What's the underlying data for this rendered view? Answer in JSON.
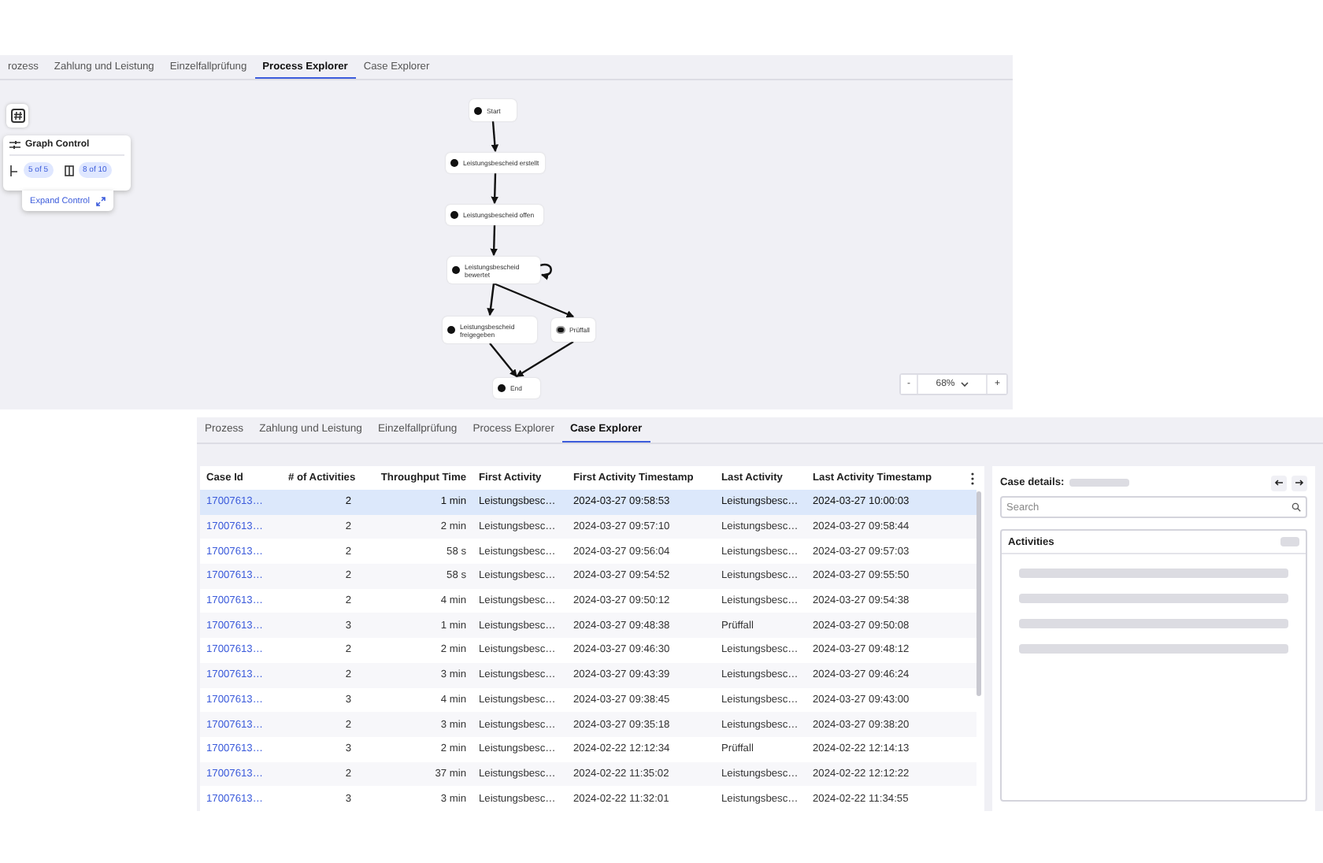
{
  "process_explorer": {
    "tabs": [
      {
        "label": "rozess",
        "selected": false
      },
      {
        "label": "Zahlung und Leistung",
        "selected": false
      },
      {
        "label": "Einzelfallprüfung",
        "selected": false
      },
      {
        "label": "Process Explorer",
        "selected": true
      },
      {
        "label": "Case Explorer",
        "selected": false
      }
    ],
    "graph_control": {
      "title": "Graph Control",
      "activities_badge": "5 of 5",
      "paths_badge": "8 of 10",
      "expand_label": "Expand Control"
    },
    "graph": {
      "nodes": [
        {
          "label": "Start",
          "kind": "start"
        },
        {
          "label": "Leistungsbescheid erstellt",
          "kind": "activity"
        },
        {
          "label": "Leistungsbescheid offen",
          "kind": "activity"
        },
        {
          "label": "Leistungsbescheid bewertet",
          "kind": "activity"
        },
        {
          "label": "Leistungsbescheid freigegeben",
          "kind": "activity"
        },
        {
          "label": "Prüffall",
          "kind": "activity"
        },
        {
          "label": "End",
          "kind": "end"
        }
      ]
    },
    "zoom": {
      "minus": "-",
      "value": "68%",
      "plus": "+"
    }
  },
  "case_explorer": {
    "tabs": [
      {
        "label": "Prozess",
        "selected": false
      },
      {
        "label": "Zahlung und Leistung",
        "selected": false
      },
      {
        "label": "Einzelfallprüfung",
        "selected": false
      },
      {
        "label": "Process Explorer",
        "selected": false
      },
      {
        "label": "Case Explorer",
        "selected": true
      }
    ],
    "table": {
      "columns": [
        "Case Id",
        "# of Activities",
        "Throughput Time",
        "First Activity",
        "First Activity Timestamp",
        "Last Activity",
        "Last Activity Timestamp"
      ],
      "rows": [
        {
          "selected": true,
          "cells": [
            "17007613…",
            "2",
            "1 min",
            "Leistungsbesc…",
            "2024-03-27 09:58:53",
            "Leistungsbesc…",
            "2024-03-27 10:00:03"
          ]
        },
        {
          "selected": false,
          "cells": [
            "17007613…",
            "2",
            "2 min",
            "Leistungsbesc…",
            "2024-03-27 09:57:10",
            "Leistungsbesc…",
            "2024-03-27 09:58:44"
          ]
        },
        {
          "selected": false,
          "cells": [
            "17007613…",
            "2",
            "58 s",
            "Leistungsbesc…",
            "2024-03-27 09:56:04",
            "Leistungsbesc…",
            "2024-03-27 09:57:03"
          ]
        },
        {
          "selected": false,
          "cells": [
            "17007613…",
            "2",
            "58 s",
            "Leistungsbesc…",
            "2024-03-27 09:54:52",
            "Leistungsbesc…",
            "2024-03-27 09:55:50"
          ]
        },
        {
          "selected": false,
          "cells": [
            "17007613…",
            "2",
            "4 min",
            "Leistungsbesc…",
            "2024-03-27 09:50:12",
            "Leistungsbesc…",
            "2024-03-27 09:54:38"
          ]
        },
        {
          "selected": false,
          "cells": [
            "17007613…",
            "3",
            "1 min",
            "Leistungsbesc…",
            "2024-03-27 09:48:38",
            "Prüffall",
            "2024-03-27 09:50:08"
          ]
        },
        {
          "selected": false,
          "cells": [
            "17007613…",
            "2",
            "2 min",
            "Leistungsbesc…",
            "2024-03-27 09:46:30",
            "Leistungsbesc…",
            "2024-03-27 09:48:12"
          ]
        },
        {
          "selected": false,
          "cells": [
            "17007613…",
            "2",
            "3 min",
            "Leistungsbesc…",
            "2024-03-27 09:43:39",
            "Leistungsbesc…",
            "2024-03-27 09:46:24"
          ]
        },
        {
          "selected": false,
          "cells": [
            "17007613…",
            "3",
            "4 min",
            "Leistungsbesc…",
            "2024-03-27 09:38:45",
            "Leistungsbesc…",
            "2024-03-27 09:43:00"
          ]
        },
        {
          "selected": false,
          "cells": [
            "17007613…",
            "2",
            "3 min",
            "Leistungsbesc…",
            "2024-03-27 09:35:18",
            "Leistungsbesc…",
            "2024-03-27 09:38:20"
          ]
        },
        {
          "selected": false,
          "cells": [
            "17007613…",
            "3",
            "2 min",
            "Leistungsbesc…",
            "2024-02-22 12:12:34",
            "Prüffall",
            "2024-02-22 12:14:13"
          ]
        },
        {
          "selected": false,
          "cells": [
            "17007613…",
            "2",
            "37 min",
            "Leistungsbesc…",
            "2024-02-22 11:35:02",
            "Leistungsbesc…",
            "2024-02-22 12:12:22"
          ]
        },
        {
          "selected": false,
          "cells": [
            "17007613…",
            "3",
            "3 min",
            "Leistungsbesc…",
            "2024-02-22 11:32:01",
            "Leistungsbesc…",
            "2024-02-22 11:34:55"
          ]
        }
      ]
    },
    "case_details": {
      "title": "Case details:",
      "search": {
        "placeholder": "Search"
      },
      "activities_title": "Activities"
    }
  }
}
